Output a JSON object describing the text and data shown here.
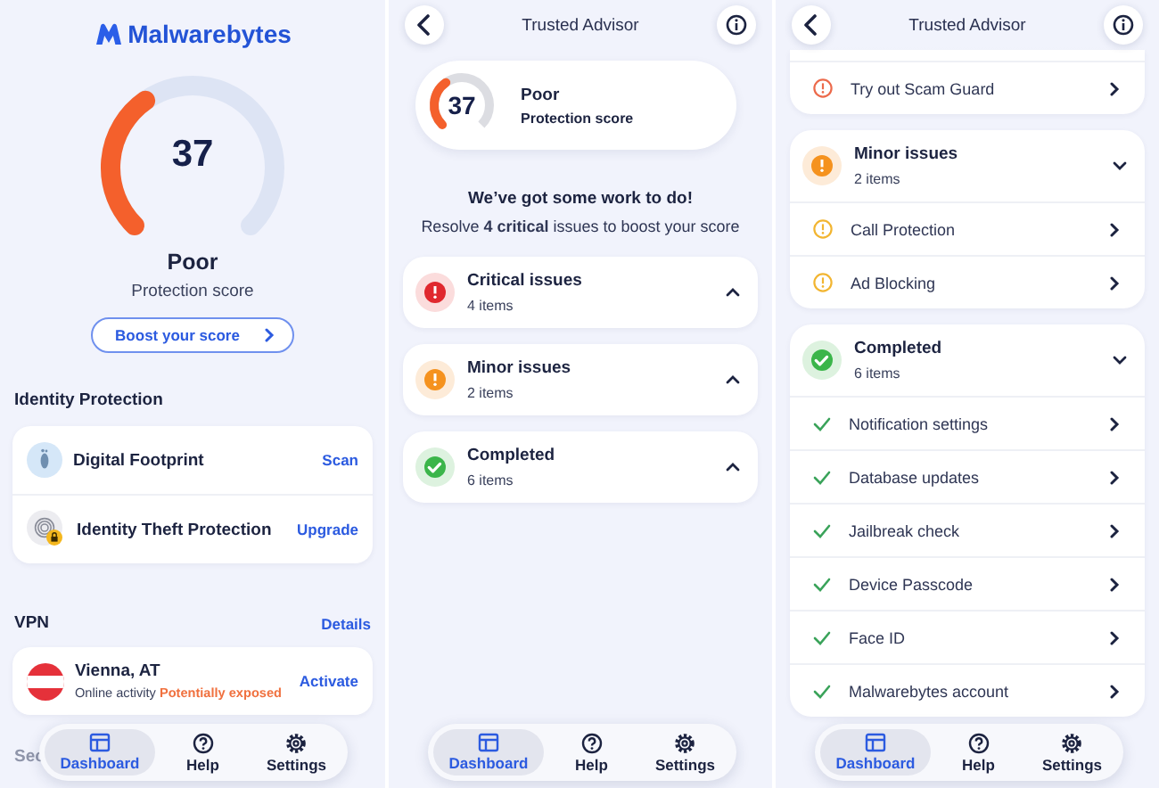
{
  "dashboard": {
    "logo": "Malwarebytes",
    "score": {
      "value": "37",
      "rating": "Poor",
      "caption": "Protection score"
    },
    "boost_button": "Boost your score",
    "identity": {
      "title": "Identity Protection",
      "items": [
        {
          "kind": "footprint",
          "name": "Digital Footprint",
          "action": "Scan"
        },
        {
          "kind": "identity",
          "name": "Identity Theft Protection",
          "action": "Upgrade"
        }
      ]
    },
    "vpn": {
      "title": "VPN",
      "details": "Details",
      "location": "Vienna, AT",
      "status_label": "Online activity",
      "status_value": "Potentially exposed",
      "action": "Activate"
    },
    "next_section": "Sec",
    "nav": [
      {
        "kind": "dashboard",
        "label": "Dashboard",
        "selected": true
      },
      {
        "kind": "help",
        "label": "Help",
        "selected": false
      },
      {
        "kind": "settings",
        "label": "Settings",
        "selected": false
      }
    ]
  },
  "advisor": {
    "title": "Trusted Advisor",
    "score": {
      "value": "37",
      "rating": "Poor",
      "caption": "Protection score"
    },
    "headline": "We’ve got some work to do!",
    "subline": "Resolve **4 critical** issues to boost your score",
    "groups": [
      {
        "kind": "critical",
        "title": "Critical issues",
        "count": "4 items",
        "expanded": false
      },
      {
        "kind": "minor",
        "title": "Minor issues",
        "count": "2 items",
        "expanded": false
      },
      {
        "kind": "completed",
        "title": "Completed",
        "count": "6 items",
        "expanded": false
      }
    ],
    "nav": [
      {
        "kind": "dashboard",
        "label": "Dashboard",
        "selected": true
      },
      {
        "kind": "help",
        "label": "Help",
        "selected": false
      },
      {
        "kind": "settings",
        "label": "Settings",
        "selected": false
      }
    ]
  },
  "advisor_expanded": {
    "title": "Trusted Advisor",
    "groups": [
      {
        "kind": "critical",
        "items": [
          {
            "label": "Try out Scam Guard"
          }
        ]
      },
      {
        "kind": "minor",
        "title": "Minor issues",
        "count": "2 items",
        "expanded": true,
        "items": [
          {
            "label": "Call Protection"
          },
          {
            "label": "Ad Blocking"
          }
        ]
      },
      {
        "kind": "completed",
        "title": "Completed",
        "count": "6 items",
        "expanded": true,
        "items": [
          {
            "label": "Notification settings"
          },
          {
            "label": "Database updates"
          },
          {
            "label": "Jailbreak check"
          },
          {
            "label": "Device Passcode"
          },
          {
            "label": "Face ID"
          },
          {
            "label": "Malwarebytes account"
          }
        ]
      }
    ],
    "nav": [
      {
        "kind": "dashboard",
        "label": "Dashboard",
        "selected": true
      },
      {
        "kind": "help",
        "label": "Help",
        "selected": false
      },
      {
        "kind": "settings",
        "label": "Settings",
        "selected": false
      }
    ]
  }
}
